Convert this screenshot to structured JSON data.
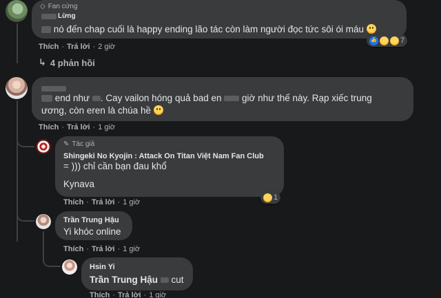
{
  "comment1": {
    "badge": "Fan cứng",
    "author": "Lừng",
    "text": "nó đến chap cuối là happy ending lão tác còn làm người đọc tức sôi ói máu",
    "actions": {
      "like": "Thích",
      "reply": "Trả lời",
      "time": "2 giờ"
    },
    "reaction_count": "7",
    "replies_label": "4 phản hồi"
  },
  "comment2": {
    "text_line1": "end như",
    "text_mid1": ". Cay vailon hóng quả bad en",
    "text_mid2": "giờ như thế này. Rạp xiếc trung",
    "text_line2": "ương, còn eren là chúa hề",
    "actions": {
      "like": "Thích",
      "reply": "Trả lời",
      "time": "1 giờ"
    }
  },
  "reply1": {
    "tag": "Tác giả",
    "author": "Shingeki No Kyojin : Attack On Titan Việt Nam Fan Club",
    "line1": "= ))) chỉ cần bạn đau khổ",
    "line2": "Kynava",
    "reaction_count": "1",
    "actions": {
      "like": "Thích",
      "reply": "Trả lời",
      "time": "1 giờ"
    }
  },
  "reply2": {
    "author": "Trần Trung Hậu",
    "text": "Yi khóc online",
    "actions": {
      "like": "Thích",
      "reply": "Trả lời",
      "time": "1 giờ"
    }
  },
  "reply3": {
    "author": "Hsin Yi",
    "mention": "Trần Trung Hậu",
    "text": "cut",
    "actions": {
      "like": "Thích",
      "reply": "Trả lời",
      "time": "1 giờ"
    }
  }
}
